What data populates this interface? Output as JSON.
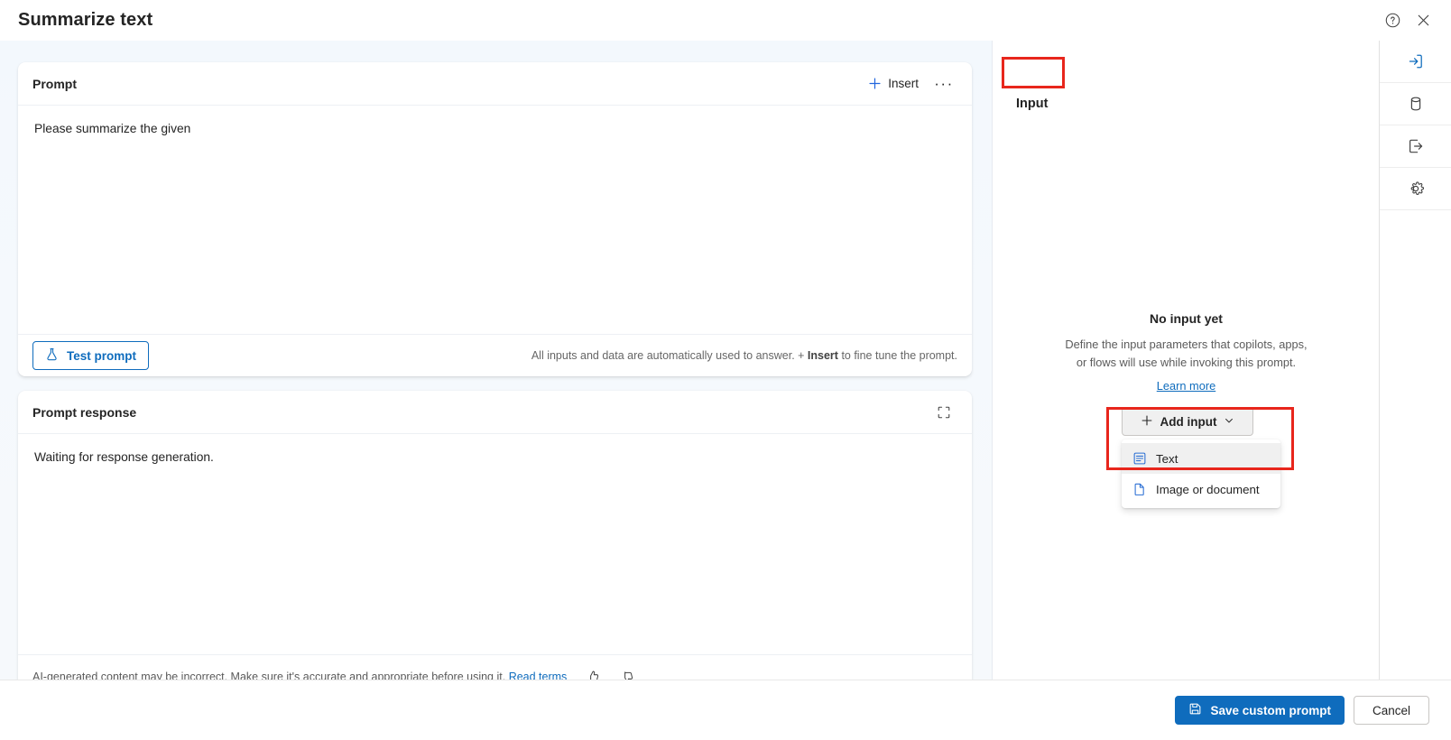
{
  "window": {
    "title": "Summarize text",
    "help_icon": "help-icon",
    "close_icon": "close-icon"
  },
  "prompt_card": {
    "title": "Prompt",
    "insert_label": "Insert",
    "insert_icon": "plus-icon",
    "more_label": "···",
    "text": "Please summarize the given",
    "test_button_label": "Test prompt",
    "test_button_icon": "flask-icon",
    "footer_note_before": "All inputs and data are automatically used to answer. + ",
    "footer_note_bold": "Insert",
    "footer_note_after": " to fine tune the prompt."
  },
  "response_card": {
    "title": "Prompt response",
    "expand_icon": "expand-icon",
    "text": "Waiting for response generation.",
    "disclaimer": "AI-generated content may be incorrect. Make sure it's accurate and appropriate before using it.",
    "read_terms_label": "Read terms",
    "thumbs_up_icon": "thumbs-up-icon",
    "thumbs_down_icon": "thumbs-down-icon"
  },
  "input_panel": {
    "heading": "Input",
    "empty_title": "No input yet",
    "empty_desc_line1": "Define the input parameters that copilots, apps,",
    "empty_desc_line2": "or flows will use while invoking this prompt.",
    "learn_more_label": "Learn more",
    "add_input_label": "Add input",
    "add_input_icon": "plus-icon",
    "add_input_chevron": "chevron-down-icon",
    "menu_items": [
      {
        "label": "Text",
        "icon": "text-lines-icon",
        "hovered": true
      },
      {
        "label": "Image or document",
        "icon": "document-icon",
        "hovered": false
      }
    ]
  },
  "rail": {
    "items": [
      {
        "name": "input",
        "icon": "arrow-into-box-icon",
        "selected": true
      },
      {
        "name": "data",
        "icon": "database-icon",
        "selected": false
      },
      {
        "name": "output",
        "icon": "arrow-out-of-box-icon",
        "selected": false
      },
      {
        "name": "settings",
        "icon": "gear-icon",
        "selected": false
      }
    ]
  },
  "action_bar": {
    "save_label": "Save custom prompt",
    "save_icon": "save-disk-icon",
    "cancel_label": "Cancel"
  },
  "colors": {
    "accent": "#0f6cbd",
    "annotation": "#e8261c",
    "canvas": "#f4f8fd",
    "card": "#ffffff"
  }
}
